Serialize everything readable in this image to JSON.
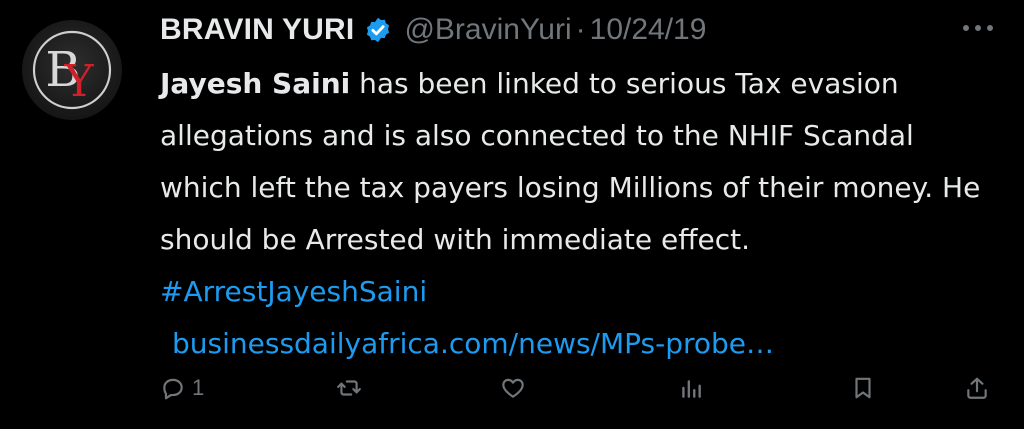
{
  "author": {
    "display_name": "BRAVIN YURI",
    "handle": "@BravinYuri",
    "separator": "·",
    "date": "10/24/19",
    "verified": true,
    "avatar_icon": "by-monogram-logo"
  },
  "tweet": {
    "mention_name": "Jayesh Saini",
    "text": " has been linked to serious Tax evasion allegations and is also connected to the NHIF Scandal which left the tax payers losing Millions of their money. He should be Arrested with immediate effect. ",
    "hashtag": "#ArrestJayeshSaini",
    "link": "businessdailyafrica.com/news/MPs-probe…"
  },
  "actions": {
    "reply_count": "1",
    "reply_icon": "reply-icon",
    "retweet_icon": "retweet-icon",
    "like_icon": "like-icon",
    "views_icon": "views-icon",
    "bookmark_icon": "bookmark-icon",
    "share_icon": "share-icon"
  },
  "colors": {
    "background": "#000000",
    "primary_text": "#e7e9ea",
    "secondary_text": "#71767b",
    "accent": "#1d9bf0"
  }
}
